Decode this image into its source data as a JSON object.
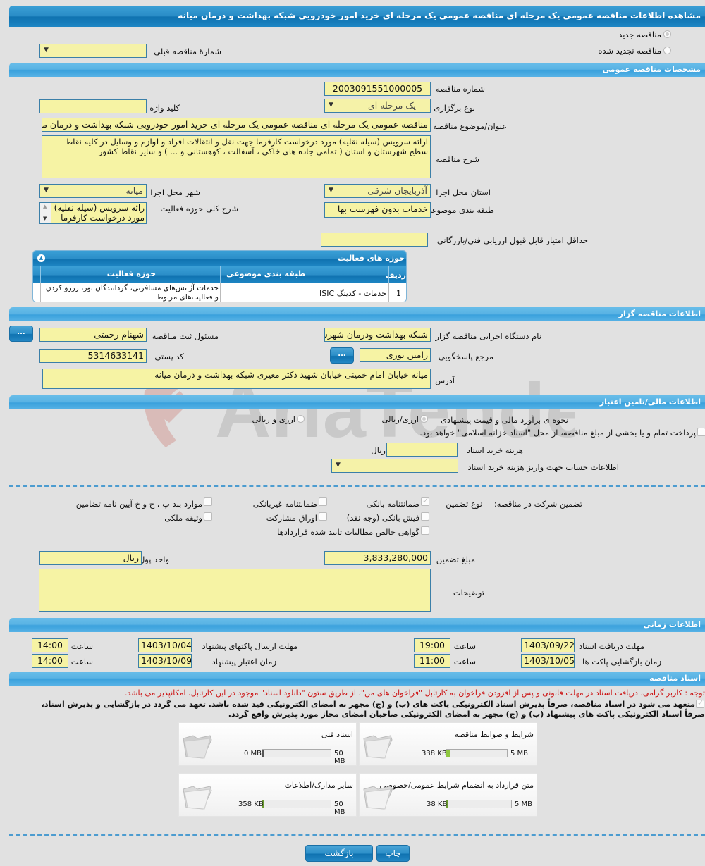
{
  "page": {
    "title": "مشاهده اطلاعات مناقصه عمومی یک مرحله ای مناقصه عمومی یک مرحله ای خرید امور خودرویی شبکه بهداشت و درمان میانه",
    "watermark": "AriaTender.neT"
  },
  "tender_type": {
    "new_label": "مناقصه جدید",
    "renewed_label": "مناقصه تجدید شده",
    "previous_number_label": "شمارهٔ مناقصه قبلی",
    "previous_number_value": "--"
  },
  "general": {
    "section_title": "مشخصات مناقصه عمومی",
    "tender_number_label": "شماره مناقصه",
    "tender_number": "2003091551000005",
    "holding_type_label": "نوع برگزاری",
    "holding_type": "یک مرحله ای",
    "keyword_label": "کلید واژه",
    "keyword": "",
    "subject_label": "عنوان/موضوع مناقصه",
    "subject": "مناقصه عمومی یک مرحله ای مناقصه عمومی یک مرحله ای خرید امور خودرویی شبکه بهداشت و درمان میانه",
    "description_label": "شرح مناقصه",
    "description": "ارائه سرویس (سیله نقلیه) مورد درخواست کارفرما جهت نقل و انتقالات افراد و لوازم و وسایل در کلیه نقاط سطح شهرستان و استان  ( تمامی جاده های خاکی ، آسفالت ، کوهستانی و ... ) و سایر نقاط کشور",
    "province_label": "استان محل اجرا",
    "province": "آذربایجان شرقی",
    "city_label": "شهر محل اجرا",
    "city": "میانه",
    "category_label": "طبقه بندی موضوعی",
    "category": "خدمات بدون فهرست بها",
    "activity_desc_label": "شرح کلی حوزه فعالیت",
    "activity_desc_lines": [
      "رائه سرویس (سیله نقلیه)",
      "مورد درخواست کارفرما"
    ],
    "min_score_label": "حداقل امتیاز قابل قبول ارزیابی فنی/بازرگانی",
    "min_score": ""
  },
  "activity_table": {
    "title": "حوزه های فعالیت",
    "columns": [
      "ردیف",
      "طبقه بندی موضوعی",
      "حوزه فعالیت"
    ],
    "rows": [
      {
        "row": "1",
        "category": "خدمات - کدینگ ISIC",
        "activity_lines": [
          "خدمات آژانس‌های مسافرتی، گردانندگان تور، رزرو کردن",
          "و فعالیت‌های مربوط"
        ]
      }
    ]
  },
  "organizer": {
    "section_title": "اطلاعات مناقصه گزار",
    "org_name_label": "نام دستگاه اجرایی مناقصه گزار",
    "org_name": "شبکه بهداشت ودرمان شهرستان میانه",
    "registrar_label": "مسئول ثبت مناقصه",
    "registrar": "شهنام رحمتی",
    "contact_label": "مرجع پاسخگویی",
    "contact": "رامین نوری",
    "postal_code_label": "کد پستی",
    "postal_code": "5314633141",
    "address_label": "آدرس",
    "address": "میانه خیابان امام خمینی خیابان شهید دکتر معیری شبکه بهداشت و درمان میانه",
    "dots_label": "..."
  },
  "finance": {
    "section_title": "اطلاعات مالی/تامین اعتبار",
    "estimate_label": "نحوه ی برآورد مالی و قیمت پیشنهادی",
    "estimate_opt1": "ارزی/ریالی",
    "estimate_opt2": "ارزی و ریالی",
    "treasury_label": "پرداخت تمام و یا بخشی از مبلغ مناقصه، از محل \"اسناد خزانه اسلامی\" خواهد بود.",
    "doc_cost_label": "هزینه خرید اسناد",
    "doc_cost": "",
    "doc_cost_unit": "ریال",
    "account_label": "اطلاعات حساب جهت واریز هزینه خرید اسناد",
    "account_value": "--"
  },
  "guarantee": {
    "title_label": "تضمین شرکت در مناقصه:",
    "type_label": "نوع تضمین",
    "options": [
      {
        "label": "ضمانتنامه بانکی",
        "checked": true
      },
      {
        "label": "ضمانتنامه غیربانکی",
        "checked": false
      },
      {
        "label": "موارد بند پ ، ح و خ آیین نامه تضامین",
        "checked": false
      },
      {
        "label": "فیش بانکی (وجه نقد)",
        "checked": false
      },
      {
        "label": "اوراق مشارکت",
        "checked": false
      },
      {
        "label": "وثیقه ملکی",
        "checked": false
      },
      {
        "label": "گواهی خالص مطالبات تایید شده قراردادها",
        "checked": false
      }
    ],
    "amount_label": "مبلغ تضمین",
    "amount": "3,833,280,000",
    "currency_label": "واحد پول",
    "currency": "ریال",
    "notes_label": "توضیحات",
    "notes": ""
  },
  "timing": {
    "section_title": "اطلاعات زمانی",
    "doc_deadline_label": "مهلت دریافت اسناد",
    "doc_deadline_date": "1403/09/22",
    "doc_deadline_time": "19:00",
    "submit_deadline_label": "مهلت ارسال پاکتهای پیشنهاد",
    "submit_deadline_date": "1403/10/04",
    "submit_deadline_time": "14:00",
    "opening_label": "زمان بازگشایی پاکت ها",
    "opening_date": "1403/10/05",
    "opening_time": "11:00",
    "validity_label": "زمان اعتبار پیشنهاد",
    "validity_date": "1403/10/09",
    "validity_time": "14:00",
    "time_label": "ساعت"
  },
  "documents": {
    "section_title": "اسناد مناقصه",
    "notice": "توجه : کاربر گرامی، دریافت اسناد در مهلت قانونی و پس از افزودن فراخوان به کارتابل \"فراخوان های من\"، از طریق ستون \"دانلود اسناد\" موجود در این کارتابل، امکانپذیر می باشد.",
    "commitment_line1": "متعهد می شود در اسناد مناقصه، صرفاً پذیرش اسناد الکترونیکی پاکت های (ب) و (ج) مجهز به امضای الکترونیکی قید شده باشد. تعهد می گردد در بازگشایی و پذیرش اسناد،",
    "commitment_line2": "صرفاً اسناد الکترونیکی پاکت های پیشنهاد (ب) و (ج) مجهز به امضای الکترونیکی صاحبان امضای مجاز مورد پذیرش واقع گردد.",
    "cards": [
      {
        "title": "شرایط و ضوابط مناقصه",
        "size": "338 KB",
        "max": "5 MB",
        "fill_fraction": 0.066
      },
      {
        "title": "اسناد فنی",
        "size": "0 MB",
        "max": "50 MB",
        "fill_fraction": 0.0
      },
      {
        "title": "متن قرارداد به انضمام شرایط عمومی/خصوصی",
        "size": "38 KB",
        "max": "5 MB",
        "fill_fraction": 0.007
      },
      {
        "title": "سایر مدارک/اطلاعات",
        "size": "358 KB",
        "max": "50 MB",
        "fill_fraction": 0.007
      }
    ]
  },
  "footer": {
    "print_label": "چاپ",
    "back_label": "بازگشت"
  }
}
